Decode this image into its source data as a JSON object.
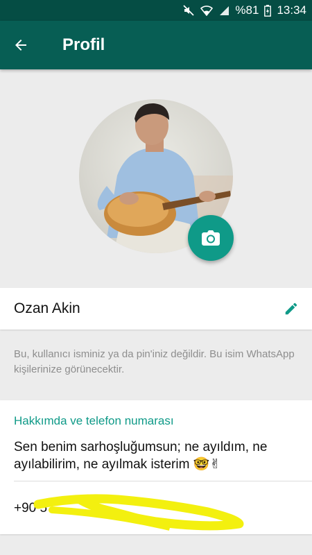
{
  "status_bar": {
    "battery": "%81",
    "time": "13:34",
    "icons": [
      "mute-icon",
      "wifi-icon",
      "signal-icon",
      "battery-icon"
    ]
  },
  "app_bar": {
    "title": "Profil",
    "back_icon": "arrow-back-icon"
  },
  "profile": {
    "name": "Ozan Akin",
    "name_hint": "Bu, kullanıcı isminiz ya da pin'iniz değildir. Bu isim WhatsApp kişilerinize görünecektir.",
    "photo_icon": "camera-icon",
    "edit_icon": "pencil-icon"
  },
  "about": {
    "heading": "Hakkımda ve telefon numarası",
    "status": "Sen benim sarhoşluğumsun; ne ayıldım, ne ayılabilirim, ne ayılmak isterim 🤓✌",
    "phone": "+90 5",
    "phone_redacted": true
  },
  "colors": {
    "app_bar": "#075e54",
    "status_bar": "#054d44",
    "accent": "#0f9a88",
    "background": "#ececec",
    "hint_text": "#8e8e8e",
    "scribble": "#f3f00f"
  }
}
